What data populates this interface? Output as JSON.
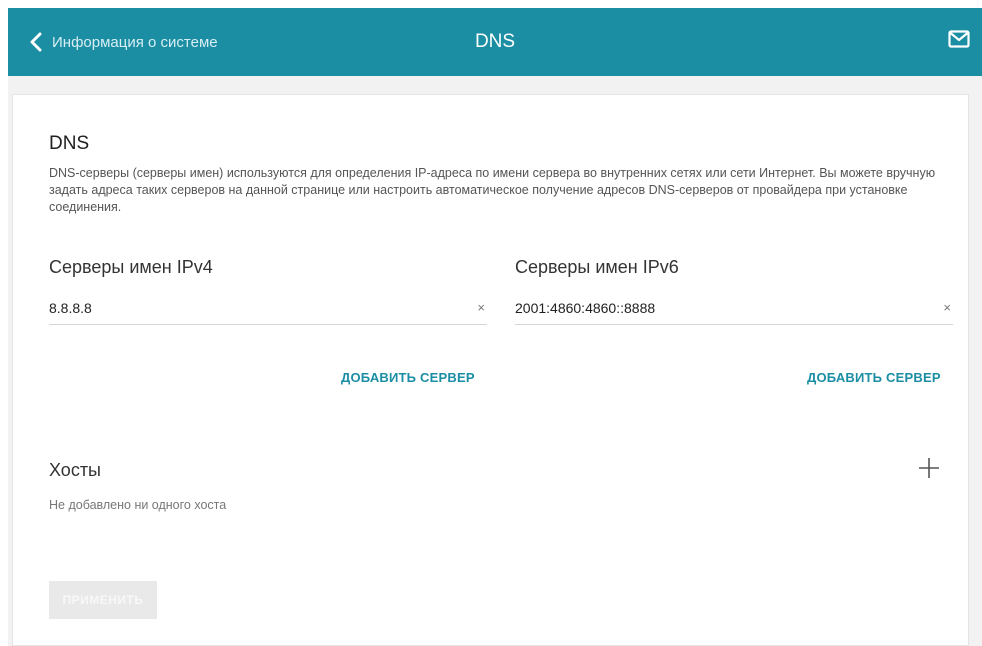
{
  "header": {
    "back_label": "Информация о системе",
    "title": "DNS",
    "accent_color": "#1b8ea4"
  },
  "dns": {
    "title": "DNS",
    "description": "DNS-серверы (серверы имен) используются для определения IP-адреса по имени сервера во внутренних сетях или сети Интернет. Вы можете вручную задать адреса таких серверов на данной странице или настроить автоматическое получение адресов DNS-серверов от провайдера при установке соединения.",
    "ipv4": {
      "title": "Серверы имен IPv4",
      "value": "8.8.8.8",
      "clear_label": "×",
      "add_label": "ДОБАВИТЬ СЕРВЕР"
    },
    "ipv6": {
      "title": "Серверы имен IPv6",
      "value": "2001:4860:4860::8888",
      "clear_label": "×",
      "add_label": "ДОБАВИТЬ СЕРВЕР"
    }
  },
  "hosts": {
    "title": "Хосты",
    "empty_text": "Не добавлено ни одного хоста"
  },
  "actions": {
    "apply_label": "ПРИМЕНИТЬ"
  },
  "icons": {
    "back": "chevron-left-icon",
    "mail": "mail-icon",
    "add": "plus-icon"
  }
}
